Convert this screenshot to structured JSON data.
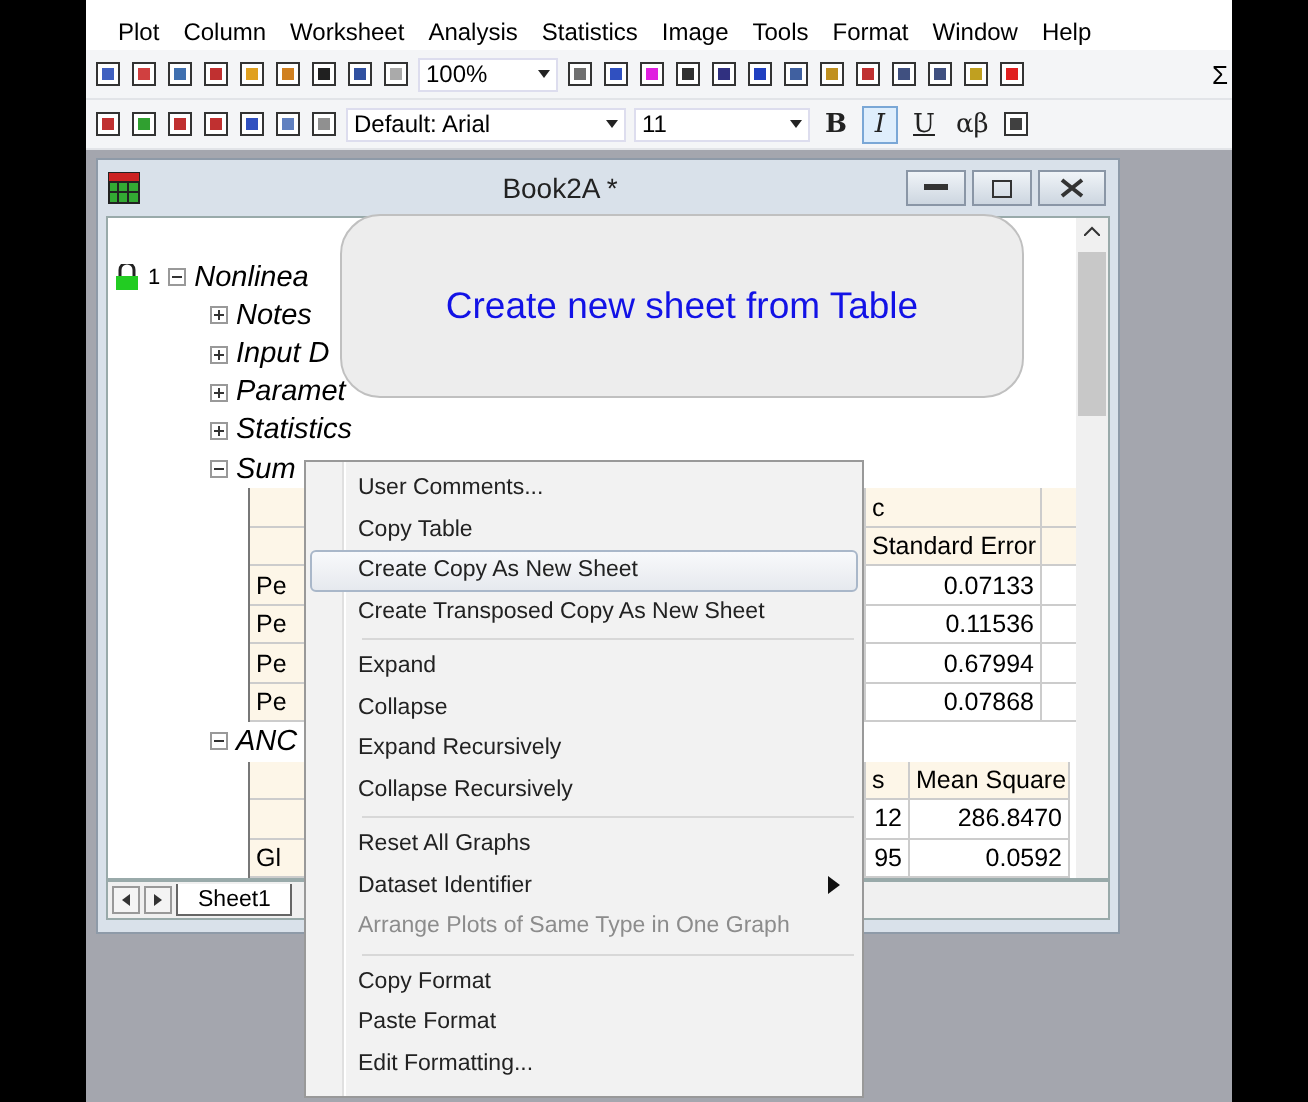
{
  "menubar": [
    "Plot",
    "Column",
    "Worksheet",
    "Analysis",
    "Statistics",
    "Image",
    "Tools",
    "Format",
    "Window",
    "Help"
  ],
  "toolbar": {
    "zoom": "100%",
    "font": "Default: Arial",
    "size": "11",
    "sigma": "Σ",
    "format_buttons": [
      {
        "label": "B",
        "selected": false
      },
      {
        "label": "I",
        "selected": true
      },
      {
        "label": "U",
        "selected": false
      },
      {
        "label": "αβ",
        "selected": false
      }
    ]
  },
  "workbook": {
    "title": "Book2A *",
    "row_number": "1",
    "report_title": "Nonlinea",
    "nodes": [
      {
        "label": "Notes",
        "expanded": false
      },
      {
        "label": "Input D",
        "expanded": false
      },
      {
        "label": "Paramet",
        "expanded": false
      },
      {
        "label": "Statistics",
        "expanded": false
      },
      {
        "label": "Sum",
        "expanded": true
      }
    ],
    "summary_table": {
      "header_1": "c",
      "header_2": "Standard Error",
      "rows": [
        {
          "label": "Pe",
          "value": "0.07133"
        },
        {
          "label": "Pe",
          "value": "0.11536"
        },
        {
          "label": "Pe",
          "value": "0.67994"
        },
        {
          "label": "Pe",
          "value": "0.07868"
        }
      ]
    },
    "anova_title": "ANC",
    "anova_table": {
      "header_1": "s",
      "header_2": "Mean Square",
      "rows": [
        {
          "label": "",
          "cells": [
            "12",
            "286.8470"
          ]
        },
        {
          "label": "Gl",
          "cells": [
            "95",
            "0.0592"
          ]
        }
      ]
    },
    "sheet_tab": "Sheet1"
  },
  "tooltip": "Create new sheet from Table",
  "context_menu": [
    {
      "kind": "item",
      "label": "User Comments...",
      "selected": false,
      "disabled": false
    },
    {
      "kind": "item",
      "label": "Copy Table",
      "selected": false,
      "disabled": false
    },
    {
      "kind": "item",
      "label": "Create Copy As New Sheet",
      "selected": true,
      "disabled": false
    },
    {
      "kind": "item",
      "label": "Create Transposed Copy As New Sheet",
      "selected": false,
      "disabled": false
    },
    {
      "kind": "separator"
    },
    {
      "kind": "item",
      "label": "Expand",
      "selected": false,
      "disabled": false
    },
    {
      "kind": "item",
      "label": "Collapse",
      "selected": false,
      "disabled": false
    },
    {
      "kind": "item",
      "label": "Expand Recursively",
      "selected": false,
      "disabled": false
    },
    {
      "kind": "item",
      "label": "Collapse Recursively",
      "selected": false,
      "disabled": false
    },
    {
      "kind": "separator"
    },
    {
      "kind": "item",
      "label": "Reset All Graphs",
      "selected": false,
      "disabled": false
    },
    {
      "kind": "submenu",
      "label": "Dataset Identifier",
      "selected": false,
      "disabled": false
    },
    {
      "kind": "item",
      "label": "Arrange Plots of Same Type in One Graph",
      "selected": false,
      "disabled": true
    },
    {
      "kind": "separator"
    },
    {
      "kind": "item",
      "label": "Copy Format",
      "selected": false,
      "disabled": false
    },
    {
      "kind": "item",
      "label": "Paste Format",
      "selected": false,
      "disabled": false
    },
    {
      "kind": "item",
      "label": "Edit Formatting...",
      "selected": false,
      "disabled": false
    }
  ]
}
